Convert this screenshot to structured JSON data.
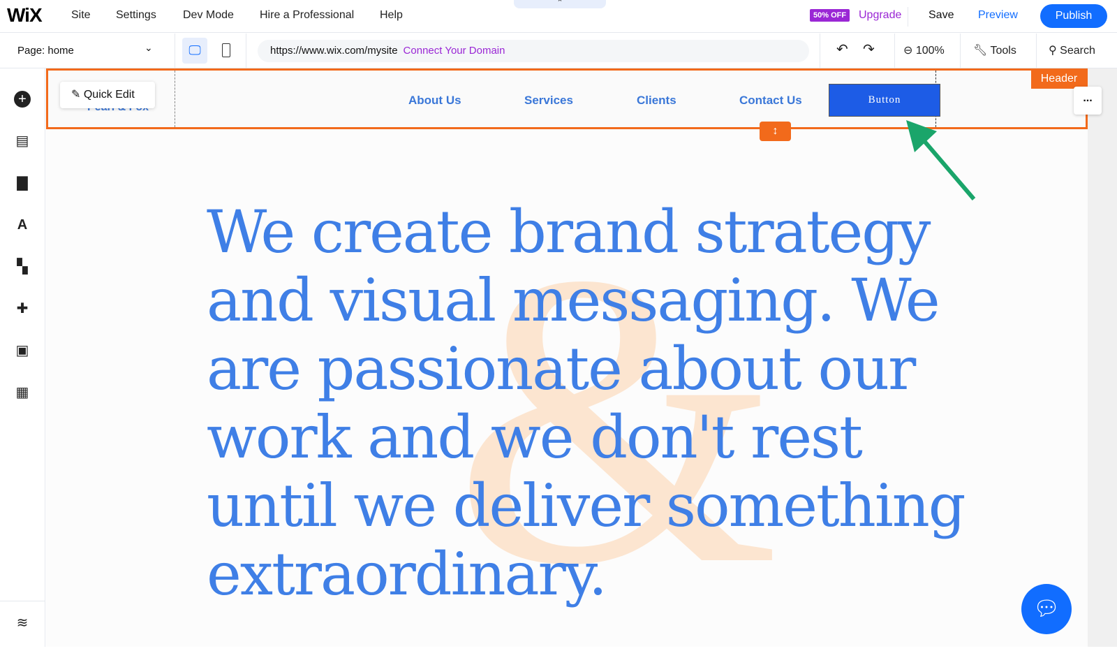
{
  "topbar": {
    "logo": "WiX",
    "menu": [
      "Site",
      "Settings",
      "Dev Mode",
      "Hire a Professional",
      "Help"
    ],
    "handle_icon": "chevron-up-icon",
    "badge": "50% OFF",
    "upgrade": "Upgrade",
    "save": "Save",
    "preview": "Preview",
    "publish": "Publish"
  },
  "toolbar": {
    "page_label": "Page: home",
    "url": "https://www.wix.com/mysite",
    "connect": "Connect Your Domain",
    "zoom": "100%",
    "tools": "Tools",
    "search": "Search"
  },
  "sidebar": {
    "icons": [
      "add-icon",
      "sections-icon",
      "pages-icon",
      "design-icon",
      "apps-icon",
      "add-apps-icon",
      "media-icon",
      "cms-icon",
      "layers-icon"
    ]
  },
  "canvas": {
    "quick_edit": "Quick Edit",
    "site_logo": "Pearl & Fox",
    "nav": [
      "About Us",
      "Services",
      "Clients",
      "Contact Us"
    ],
    "button": "Button",
    "header_tag": "Header",
    "more": "...",
    "headline": "We create brand strategy and visual messaging. We are passionate about our work and we don't rest until we deliver something extraordinary.",
    "bg_glyph": "&"
  },
  "colors": {
    "accent": "#116dff",
    "selection": "#f26a1b",
    "text_blue": "#3f7fe6",
    "upgrade": "#9a27d5",
    "arrow": "#1aa56a"
  }
}
